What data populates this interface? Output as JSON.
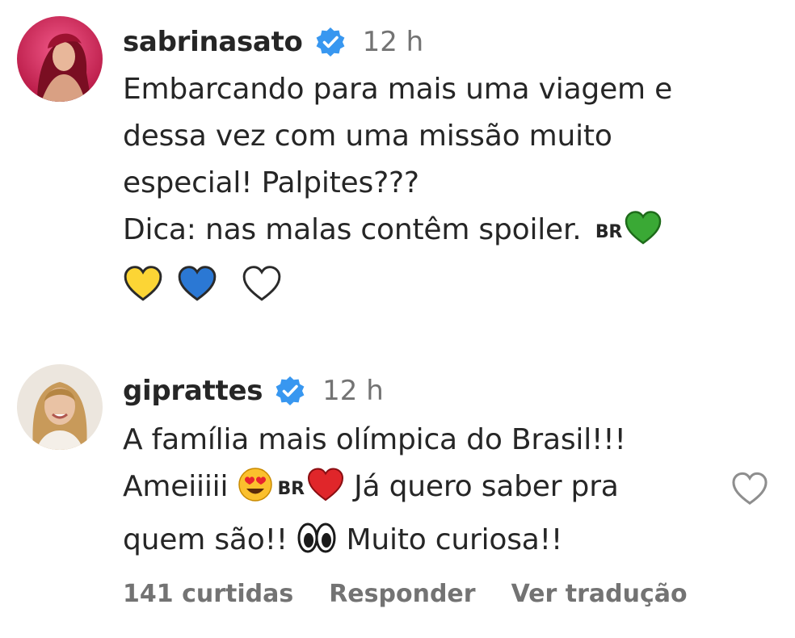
{
  "comments": [
    {
      "username": "sabrinasato",
      "time": "12 h",
      "lines": [
        "Embarcando para mais uma viagem e",
        "dessa vez com uma missão muito",
        "especial! Palpites???",
        "Dica: nas malas contêm spoiler."
      ],
      "flag": "BR"
    },
    {
      "username": "giprattes",
      "time": "12 h",
      "line1": "A família mais olímpica do Brasil!!!",
      "line2a": "Ameiiiii",
      "flag": "BR",
      "line2b": "Já quero saber pra",
      "line3a": "quem são!!",
      "line3b": "Muito curiosa!!",
      "likes": "141 curtidas",
      "reply": "Responder",
      "translate": "Ver tradução"
    }
  ],
  "colors": {
    "verified": "#3897f0",
    "green_heart": "#3aa935",
    "yellow_heart": "#fcd535",
    "blue_heart": "#2b78d4",
    "red_heart": "#e0262a"
  }
}
